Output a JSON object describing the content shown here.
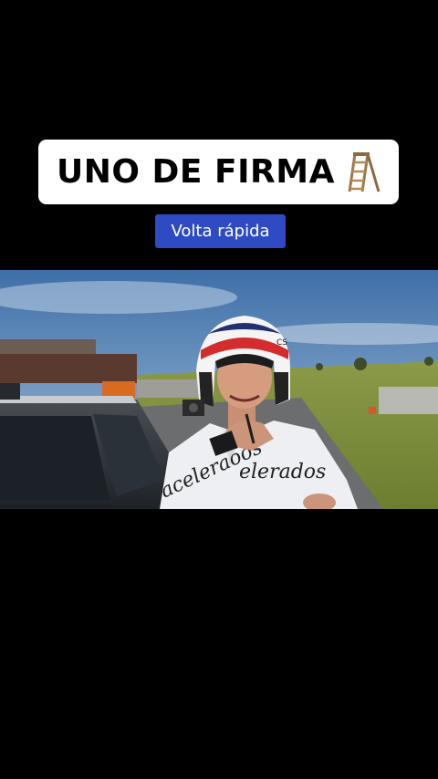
{
  "overlay": {
    "title": "UNO DE FIRMA",
    "title_icon": "ladder-icon",
    "subtitle": "Volta rápida"
  },
  "video": {
    "jacket_left_text": "aceleraoos",
    "jacket_right_text": "elerados",
    "helmet_text": "CS"
  },
  "colors": {
    "background": "#000000",
    "title_card": "#ffffff",
    "subtitle_chip": "#2e4bc4"
  }
}
